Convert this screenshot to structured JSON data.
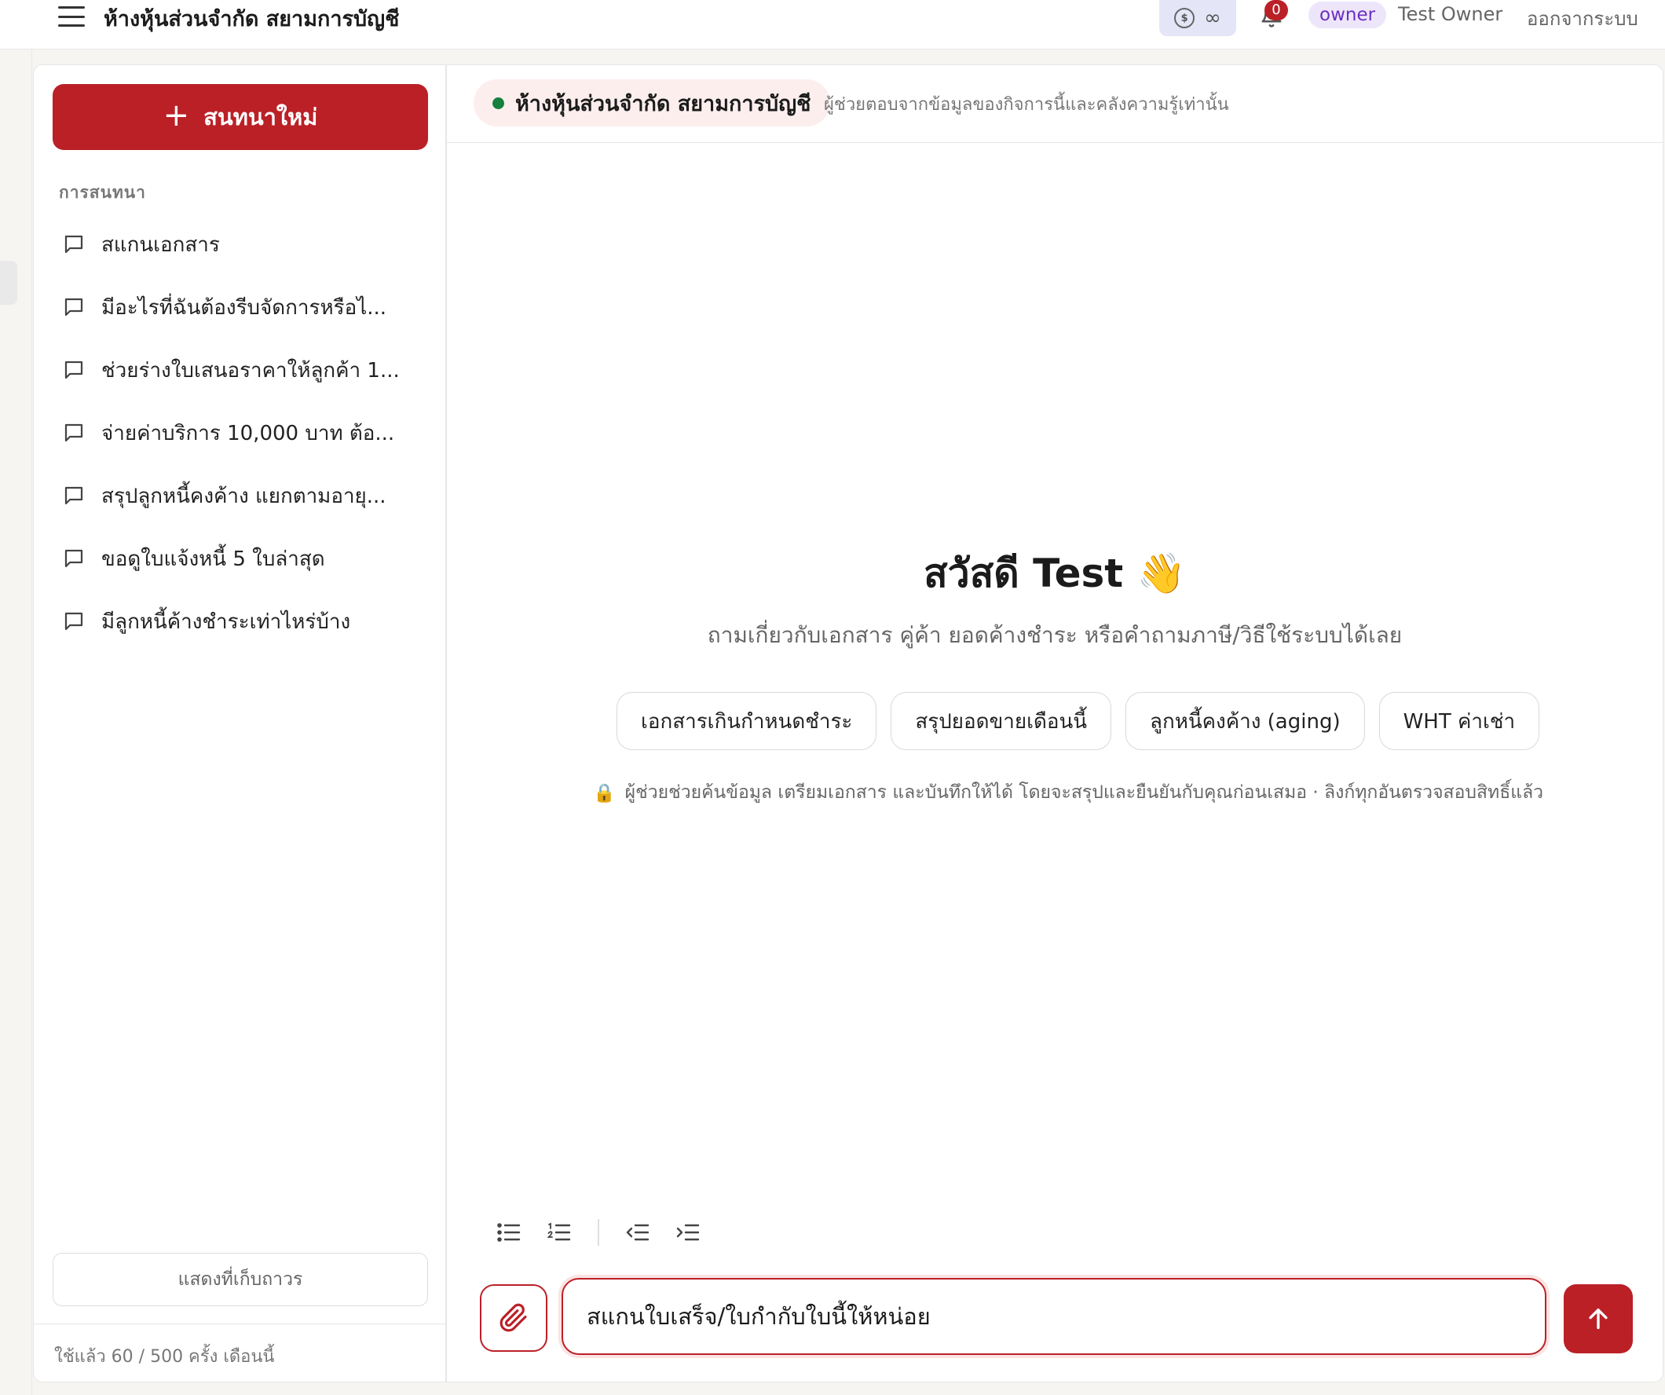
{
  "header": {
    "company_name": "ห้างหุ้นส่วนจำกัด สยามการบัญชี",
    "credits_symbol": "∞",
    "notification_count": "0",
    "role": "owner",
    "user_name": "Test Owner",
    "logout_label": "ออกจากระบบ"
  },
  "sidebar": {
    "new_chat_label": "สนทนาใหม่",
    "section_label": "การสนทนา",
    "conversations": [
      "สแกนเอกสาร",
      "มีอะไรที่ฉันต้องรีบจัดการหรือไ...",
      "ช่วยร่างใบเสนอราคาให้ลูกค้า 1...",
      "จ่ายค่าบริการ 10,000 บาท ต้อ...",
      "สรุปลูกหนี้คงค้าง แยกตามอายุ...",
      "ขอดูใบแจ้งหนี้ 5 ใบล่าสุด",
      "มีลูกหนี้ค้างชำระเท่าไหร่บ้าง"
    ],
    "archive_label": "แสดงที่เก็บถาวร",
    "usage_text": "ใช้แล้ว 60 / 500 ครั้ง เดือนนี้"
  },
  "main": {
    "scope_company": "ห้างหุ้นส่วนจำกัด สยามการบัญชี",
    "scope_note": "ผู้ช่วยตอบจากข้อมูลของกิจการนี้และคลังความรู้เท่านั้น",
    "greeting": "สวัสดี Test 👋",
    "subtitle": "ถามเกี่ยวกับเอกสาร คู่ค้า ยอดค้างชำระ หรือคำถามภาษี/วิธีใช้ระบบได้เลย",
    "suggestions": [
      "เอกสารเกินกำหนดชำระ",
      "สรุปยอดขายเดือนนี้",
      "ลูกหนี้คงค้าง (aging)",
      "WHT ค่าเช่า"
    ],
    "notice_icon": "🔒",
    "notice": "ผู้ช่วยช่วยค้นข้อมูล เตรียมเอกสาร และบันทึกให้ได้ โดยจะสรุปและยืนยันกับคุณก่อนเสมอ · ลิงก์ทุกอันตรวจสอบสิทธิ์แล้ว",
    "input_value": "สแกนใบเสร็จ/ใบกำกับใบนี้ให้หน่อย"
  },
  "colors": {
    "accent": "#bb2027",
    "status_green": "#16803c",
    "role_purple": "#6b2fc2"
  },
  "icons": [
    "menu-icon",
    "coin-icon",
    "bell-icon",
    "plus-icon",
    "chat-bubble-icon",
    "bullet-list-icon",
    "numbered-list-icon",
    "outdent-icon",
    "indent-icon",
    "paperclip-icon",
    "arrow-up-icon",
    "lock-icon"
  ]
}
